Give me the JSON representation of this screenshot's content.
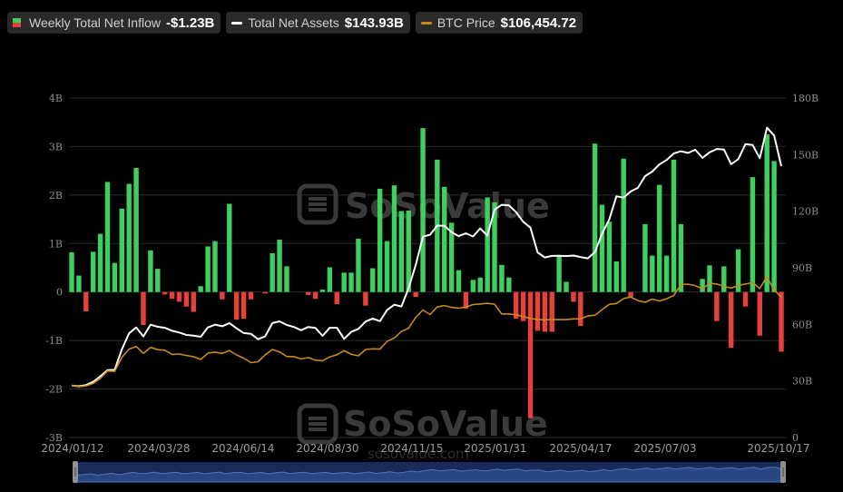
{
  "legend": {
    "inflow": {
      "label": "Weekly Total Net Inflow",
      "value": "-$1.23B"
    },
    "assets": {
      "label": "Total Net Assets",
      "value": "$143.93B"
    },
    "price": {
      "label": "BTC Price",
      "value": "$106,454.72"
    }
  },
  "watermark": {
    "brand": "SoSoValue",
    "url": "sosovalue.com"
  },
  "colors": {
    "positive": "#3ecf5e",
    "negative": "#e8413c",
    "assets": "#ffffff",
    "price": "#c8891e",
    "navigator": "#1a2b57"
  },
  "chart_data": {
    "type": "bar+line",
    "left_axis": {
      "ticks": [
        "4B",
        "3B",
        "2B",
        "1B",
        "0",
        "-1B",
        "-2B",
        "-3B"
      ],
      "min": -3,
      "max": 4,
      "unit": "B"
    },
    "right_axis": {
      "ticks": [
        "180B",
        "150B",
        "120B",
        "90B",
        "60B",
        "30B",
        "0"
      ],
      "min": 0,
      "max": 180,
      "unit": "B"
    },
    "x_ticks": [
      "2024/01/12",
      "2024/03/28",
      "2024/06/14",
      "2024/08/30",
      "2024/11/15",
      "2025/01/31",
      "2025/04/17",
      "2025/07/03",
      "2025/10/17"
    ],
    "weekly_net_inflow_B": [
      0.82,
      0.34,
      -0.4,
      0.83,
      1.2,
      2.27,
      0.6,
      1.72,
      2.23,
      2.56,
      -0.68,
      0.86,
      0.48,
      -0.05,
      -0.14,
      -0.2,
      -0.3,
      -0.41,
      0.12,
      0.94,
      1.05,
      -0.15,
      1.82,
      -0.57,
      -0.55,
      -0.15,
      0.0,
      -0.03,
      0.8,
      1.08,
      0.53,
      0.0,
      0.0,
      -0.06,
      -0.14,
      0.05,
      0.51,
      -0.25,
      0.4,
      0.4,
      1.1,
      -0.28,
      0.49,
      2.13,
      1.05,
      2.2,
      1.67,
      1.68,
      -0.1,
      3.38,
      0.0,
      2.73,
      2.17,
      1.43,
      0.45,
      -0.34,
      0.25,
      0.3,
      1.95,
      1.85,
      0.56,
      0.3,
      -0.55,
      -0.6,
      -2.6,
      -0.8,
      -0.82,
      -0.82,
      0.74,
      0.21,
      -0.2,
      -0.7,
      0.0,
      3.06,
      1.8,
      1.45,
      0.63,
      2.75,
      -0.1,
      0.0,
      1.4,
      0.75,
      2.21,
      0.75,
      2.73,
      1.4,
      0.0,
      0.0,
      0.27,
      0.55,
      -0.6,
      0.53,
      -1.15,
      0.88,
      -0.3,
      2.37,
      -0.9,
      3.25,
      2.7,
      -1.23
    ],
    "total_net_assets_B": [
      27.6,
      27.2,
      27.8,
      29.5,
      32.5,
      35.7,
      35.9,
      46.8,
      55.2,
      58.4,
      53.6,
      59.8,
      58.7,
      58.2,
      56.6,
      55.7,
      54.4,
      54.0,
      53.4,
      58.4,
      59.8,
      59.0,
      60.7,
      57.9,
      55.4,
      55.0,
      52.1,
      53.7,
      60.7,
      61.6,
      59.7,
      58.6,
      56.9,
      58.6,
      58.1,
      53.9,
      58.2,
      58.2,
      52.3,
      56.0,
      57.6,
      61.5,
      63.1,
      61.7,
      67.6,
      70.4,
      69.5,
      79.2,
      91.6,
      106.5,
      107.5,
      112.4,
      112.3,
      108.9,
      106.8,
      108.3,
      106.6,
      110.9,
      107.0,
      120.8,
      123.4,
      123.1,
      119.5,
      114.4,
      111.3,
      98.2,
      95.5,
      96.3,
      96.4,
      96.2,
      96.5,
      95.7,
      95.0,
      98.3,
      108.1,
      115.6,
      127.9,
      127.2,
      130.5,
      132.4,
      138.6,
      141.0,
      144.8,
      147.2,
      150.6,
      151.8,
      150.9,
      152.6,
      148.3,
      151.2,
      153.0,
      152.7,
      144.9,
      147.6,
      155.6,
      155.1,
      148.1,
      164.3,
      160.1,
      143.9
    ],
    "btc_price_unit": "plotted on the right axis scale",
    "btc_price": [
      27.6,
      26.9,
      27.4,
      28.7,
      31.4,
      35.3,
      35.1,
      42.5,
      46.9,
      48.3,
      44.6,
      47.8,
      46.6,
      46.3,
      44.1,
      44.3,
      43.5,
      42.9,
      41.4,
      44.7,
      45.3,
      44.6,
      46.1,
      43.8,
      42.1,
      39.7,
      40.2,
      43.9,
      46.7,
      45.4,
      43.0,
      42.9,
      41.7,
      42.4,
      41.0,
      40.7,
      42.8,
      43.9,
      46.1,
      44.1,
      43.3,
      46.7,
      47.0,
      46.9,
      51.0,
      52.8,
      56.2,
      58.0,
      63.7,
      67.6,
      65.2,
      69.2,
      70.0,
      69.0,
      68.6,
      69.2,
      70.5,
      70.8,
      71.2,
      70.7,
      65.5,
      65.5,
      65.1,
      64.1,
      63.2,
      62.5,
      62.4,
      62.5,
      62.5,
      62.5,
      62.9,
      62.9,
      64.4,
      64.9,
      67.8,
      70.6,
      71.1,
      73.7,
      74.5,
      72.6,
      71.7,
      73.4,
      72.4,
      73.6,
      75.3,
      81.1,
      81.3,
      80.5,
      78.9,
      81.8,
      81.4,
      80.2,
      79.2,
      80.6,
      81.4,
      82.1,
      79.0,
      85.4,
      78.1,
      74.6
    ]
  }
}
